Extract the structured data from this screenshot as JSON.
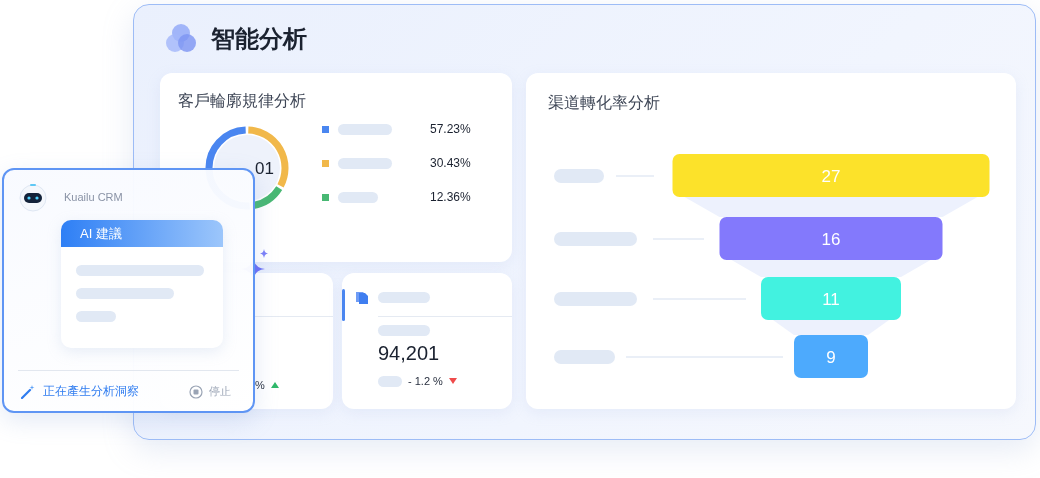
{
  "window": {
    "title": "智能分析"
  },
  "customer_profile": {
    "title": "客戶輪廓規律分析",
    "donut_center": "01",
    "legend": [
      {
        "color": "#4a86f0",
        "share": "57.23%"
      },
      {
        "color": "#f1b84a",
        "share": "30.43%"
      },
      {
        "color": "#48b873",
        "share": "12.36%"
      }
    ]
  },
  "metric_cards": [
    {
      "change": "%",
      "rising": true
    },
    {
      "value": "94,201",
      "change": "- 1.2 %",
      "rising": false
    }
  ],
  "funnel": {
    "title": "渠道轉化率分析",
    "stages": [
      {
        "value": "27",
        "color": "#fce22a"
      },
      {
        "value": "16",
        "color": "#8379fc"
      },
      {
        "value": "11",
        "color": "#42f2e0"
      },
      {
        "value": "9",
        "color": "#4daafd"
      }
    ]
  },
  "assistant": {
    "brand": "Kuailu CRM",
    "card_title": "AI 建議",
    "status": "正在產生分析洞察",
    "stop_label": "停止"
  }
}
